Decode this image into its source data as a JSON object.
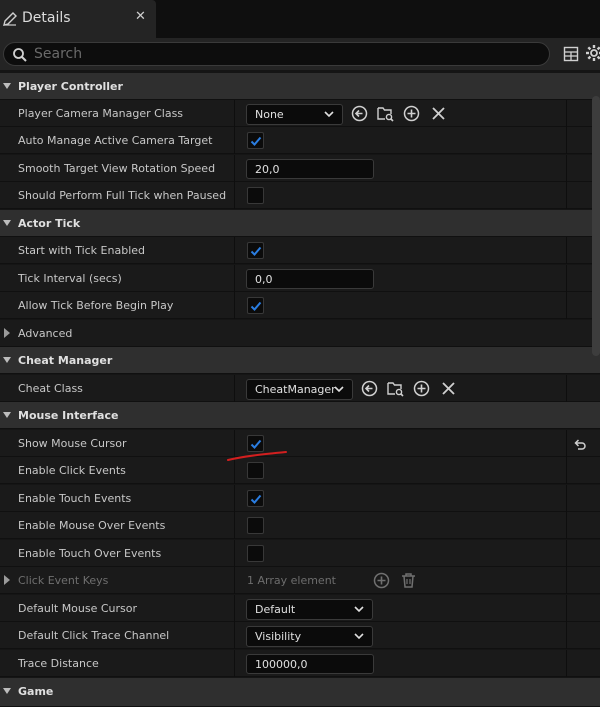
{
  "tab": {
    "title": "Details",
    "close": "✕"
  },
  "search": {
    "placeholder": "Search"
  },
  "icons": {
    "tab": "details-pencil-icon",
    "search": "search-icon",
    "table_view": "table-view-icon",
    "settings": "gear-icon",
    "browse": "browse-arrow-icon",
    "find_asset": "find-asset-icon",
    "add": "plus-circle-icon",
    "clear": "close-x-icon",
    "trash": "trash-icon",
    "reset": "reset-to-default-icon"
  },
  "colors": {
    "accent": "#2a7de1",
    "annotation": "#d21f1f"
  },
  "sections": {
    "player_controller": {
      "title": "Player Controller",
      "camera_manager": {
        "label": "Player Camera Manager Class",
        "value": "None"
      },
      "auto_manage": {
        "label": "Auto Manage Active Camera Target",
        "checked": true
      },
      "smooth_rotation": {
        "label": "Smooth Target View Rotation Speed",
        "value": "20,0"
      },
      "full_tick_paused": {
        "label": "Should Perform Full Tick when Paused",
        "checked": false
      }
    },
    "actor_tick": {
      "title": "Actor Tick",
      "start_tick": {
        "label": "Start with Tick Enabled",
        "checked": true
      },
      "tick_interval": {
        "label": "Tick Interval (secs)",
        "value": "0,0"
      },
      "allow_tick_before": {
        "label": "Allow Tick Before Begin Play",
        "checked": true
      },
      "advanced": {
        "label": "Advanced"
      }
    },
    "cheat_manager": {
      "title": "Cheat Manager",
      "cheat_class": {
        "label": "Cheat Class",
        "value": "CheatManager"
      }
    },
    "mouse_interface": {
      "title": "Mouse Interface",
      "show_cursor": {
        "label": "Show Mouse Cursor",
        "checked": true
      },
      "click_events": {
        "label": "Enable Click Events",
        "checked": false
      },
      "touch_events": {
        "label": "Enable Touch Events",
        "checked": true
      },
      "mouse_over": {
        "label": "Enable Mouse Over Events",
        "checked": false
      },
      "touch_over": {
        "label": "Enable Touch Over Events",
        "checked": false
      },
      "click_keys": {
        "label": "Click Event Keys",
        "value": "1 Array element"
      },
      "default_cursor": {
        "label": "Default Mouse Cursor",
        "value": "Default"
      },
      "trace_channel": {
        "label": "Default Click Trace Channel",
        "value": "Visibility"
      },
      "trace_distance": {
        "label": "Trace Distance",
        "value": "100000,0"
      }
    },
    "game": {
      "title": "Game"
    }
  }
}
